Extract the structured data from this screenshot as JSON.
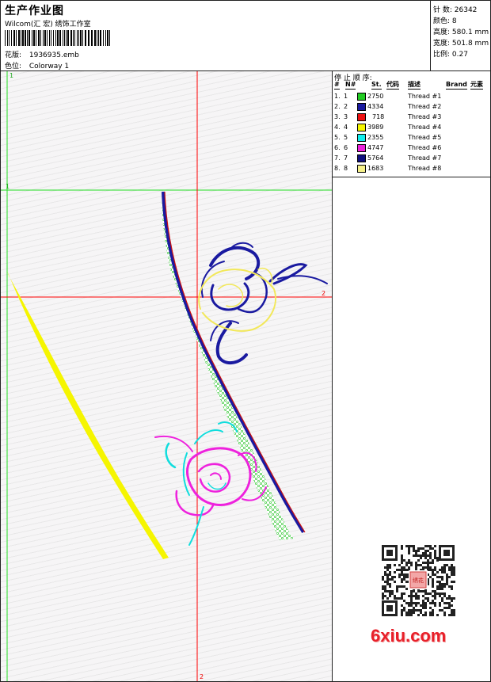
{
  "header": {
    "title": "生产作业图",
    "company": "Wilcom(汇 宏) 绣饰工作室",
    "design_label": "花版:",
    "design_value": "1936935.emb",
    "colorway_label": "色位:",
    "colorway_value": "Colorway 1"
  },
  "stats": {
    "stitches_label": "针 数:",
    "stitches_value": "26342",
    "colors_label": "颜色:",
    "colors_value": "8",
    "height_label": "高度:",
    "height_value": "580.1 mm",
    "width_label": "宽度:",
    "width_value": "501.8 mm",
    "scale_label": "比例:",
    "scale_value": "0.27"
  },
  "canvas": {
    "marker_1_top": "1",
    "marker_1_left": "1",
    "marker_2_right": "2",
    "marker_2_bottom": "2",
    "flower_colors": {
      "stem_fill": "#44cc44",
      "stem_edge": "#e01010",
      "blue": "#1a1aa0",
      "yellow": "#f0f020",
      "cyan": "#22dddd",
      "magenta": "#ee22dd",
      "guide_red": "#ff0000",
      "guide_green": "#22dd22"
    }
  },
  "side": {
    "stop_title": "停 止 顺 序:",
    "headers": {
      "hash": "#",
      "n": "N#",
      "st": "St.",
      "code": "代码",
      "desc": "描述",
      "brand": "Brand",
      "element": "元素"
    },
    "threads": [
      {
        "num": "1.",
        "n": "1",
        "st": "2750",
        "desc": "Thread #1",
        "color": "#22cc22"
      },
      {
        "num": "2.",
        "n": "2",
        "st": "4334",
        "desc": "Thread #2",
        "color": "#1a1aa0"
      },
      {
        "num": "3.",
        "n": "3",
        "st": "718",
        "desc": "Thread #3",
        "color": "#ee1111"
      },
      {
        "num": "4.",
        "n": "4",
        "st": "3989",
        "desc": "Thread #4",
        "color": "#f5f500"
      },
      {
        "num": "5.",
        "n": "5",
        "st": "2355",
        "desc": "Thread #5",
        "color": "#11eeee"
      },
      {
        "num": "6.",
        "n": "6",
        "st": "4747",
        "desc": "Thread #6",
        "color": "#ee22dd"
      },
      {
        "num": "7.",
        "n": "7",
        "st": "5764",
        "desc": "Thread #7",
        "color": "#101080"
      },
      {
        "num": "8.",
        "n": "8",
        "st": "1683",
        "desc": "Thread #8",
        "color": "#f5f08a"
      }
    ],
    "watermark": "6xiu.com",
    "qr_seal_text": "绣花"
  }
}
